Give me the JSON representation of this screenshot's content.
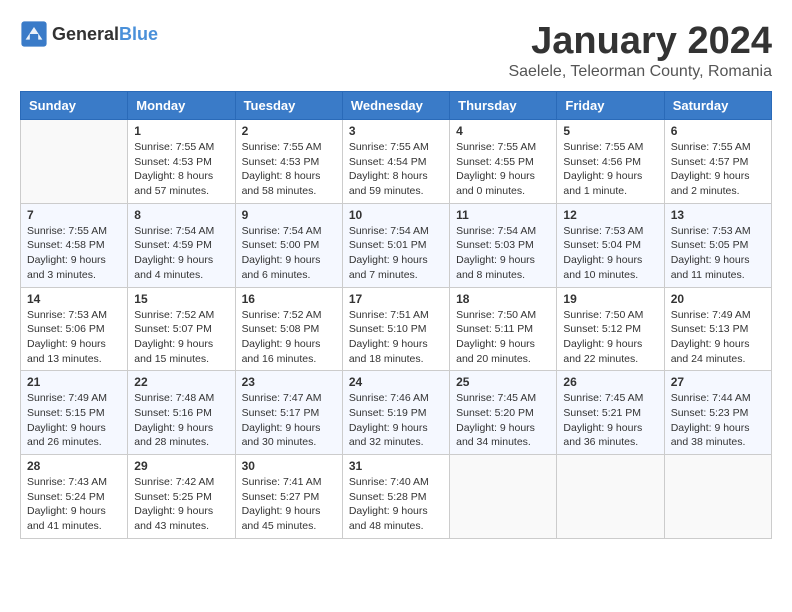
{
  "header": {
    "logo_general": "General",
    "logo_blue": "Blue",
    "month": "January 2024",
    "location": "Saelele, Teleorman County, Romania"
  },
  "weekdays": [
    "Sunday",
    "Monday",
    "Tuesday",
    "Wednesday",
    "Thursday",
    "Friday",
    "Saturday"
  ],
  "weeks": [
    [
      {
        "day": "",
        "info": ""
      },
      {
        "day": "1",
        "info": "Sunrise: 7:55 AM\nSunset: 4:53 PM\nDaylight: 8 hours\nand 57 minutes."
      },
      {
        "day": "2",
        "info": "Sunrise: 7:55 AM\nSunset: 4:53 PM\nDaylight: 8 hours\nand 58 minutes."
      },
      {
        "day": "3",
        "info": "Sunrise: 7:55 AM\nSunset: 4:54 PM\nDaylight: 8 hours\nand 59 minutes."
      },
      {
        "day": "4",
        "info": "Sunrise: 7:55 AM\nSunset: 4:55 PM\nDaylight: 9 hours\nand 0 minutes."
      },
      {
        "day": "5",
        "info": "Sunrise: 7:55 AM\nSunset: 4:56 PM\nDaylight: 9 hours\nand 1 minute."
      },
      {
        "day": "6",
        "info": "Sunrise: 7:55 AM\nSunset: 4:57 PM\nDaylight: 9 hours\nand 2 minutes."
      }
    ],
    [
      {
        "day": "7",
        "info": "Sunrise: 7:55 AM\nSunset: 4:58 PM\nDaylight: 9 hours\nand 3 minutes."
      },
      {
        "day": "8",
        "info": "Sunrise: 7:54 AM\nSunset: 4:59 PM\nDaylight: 9 hours\nand 4 minutes."
      },
      {
        "day": "9",
        "info": "Sunrise: 7:54 AM\nSunset: 5:00 PM\nDaylight: 9 hours\nand 6 minutes."
      },
      {
        "day": "10",
        "info": "Sunrise: 7:54 AM\nSunset: 5:01 PM\nDaylight: 9 hours\nand 7 minutes."
      },
      {
        "day": "11",
        "info": "Sunrise: 7:54 AM\nSunset: 5:03 PM\nDaylight: 9 hours\nand 8 minutes."
      },
      {
        "day": "12",
        "info": "Sunrise: 7:53 AM\nSunset: 5:04 PM\nDaylight: 9 hours\nand 10 minutes."
      },
      {
        "day": "13",
        "info": "Sunrise: 7:53 AM\nSunset: 5:05 PM\nDaylight: 9 hours\nand 11 minutes."
      }
    ],
    [
      {
        "day": "14",
        "info": "Sunrise: 7:53 AM\nSunset: 5:06 PM\nDaylight: 9 hours\nand 13 minutes."
      },
      {
        "day": "15",
        "info": "Sunrise: 7:52 AM\nSunset: 5:07 PM\nDaylight: 9 hours\nand 15 minutes."
      },
      {
        "day": "16",
        "info": "Sunrise: 7:52 AM\nSunset: 5:08 PM\nDaylight: 9 hours\nand 16 minutes."
      },
      {
        "day": "17",
        "info": "Sunrise: 7:51 AM\nSunset: 5:10 PM\nDaylight: 9 hours\nand 18 minutes."
      },
      {
        "day": "18",
        "info": "Sunrise: 7:50 AM\nSunset: 5:11 PM\nDaylight: 9 hours\nand 20 minutes."
      },
      {
        "day": "19",
        "info": "Sunrise: 7:50 AM\nSunset: 5:12 PM\nDaylight: 9 hours\nand 22 minutes."
      },
      {
        "day": "20",
        "info": "Sunrise: 7:49 AM\nSunset: 5:13 PM\nDaylight: 9 hours\nand 24 minutes."
      }
    ],
    [
      {
        "day": "21",
        "info": "Sunrise: 7:49 AM\nSunset: 5:15 PM\nDaylight: 9 hours\nand 26 minutes."
      },
      {
        "day": "22",
        "info": "Sunrise: 7:48 AM\nSunset: 5:16 PM\nDaylight: 9 hours\nand 28 minutes."
      },
      {
        "day": "23",
        "info": "Sunrise: 7:47 AM\nSunset: 5:17 PM\nDaylight: 9 hours\nand 30 minutes."
      },
      {
        "day": "24",
        "info": "Sunrise: 7:46 AM\nSunset: 5:19 PM\nDaylight: 9 hours\nand 32 minutes."
      },
      {
        "day": "25",
        "info": "Sunrise: 7:45 AM\nSunset: 5:20 PM\nDaylight: 9 hours\nand 34 minutes."
      },
      {
        "day": "26",
        "info": "Sunrise: 7:45 AM\nSunset: 5:21 PM\nDaylight: 9 hours\nand 36 minutes."
      },
      {
        "day": "27",
        "info": "Sunrise: 7:44 AM\nSunset: 5:23 PM\nDaylight: 9 hours\nand 38 minutes."
      }
    ],
    [
      {
        "day": "28",
        "info": "Sunrise: 7:43 AM\nSunset: 5:24 PM\nDaylight: 9 hours\nand 41 minutes."
      },
      {
        "day": "29",
        "info": "Sunrise: 7:42 AM\nSunset: 5:25 PM\nDaylight: 9 hours\nand 43 minutes."
      },
      {
        "day": "30",
        "info": "Sunrise: 7:41 AM\nSunset: 5:27 PM\nDaylight: 9 hours\nand 45 minutes."
      },
      {
        "day": "31",
        "info": "Sunrise: 7:40 AM\nSunset: 5:28 PM\nDaylight: 9 hours\nand 48 minutes."
      },
      {
        "day": "",
        "info": ""
      },
      {
        "day": "",
        "info": ""
      },
      {
        "day": "",
        "info": ""
      }
    ]
  ]
}
